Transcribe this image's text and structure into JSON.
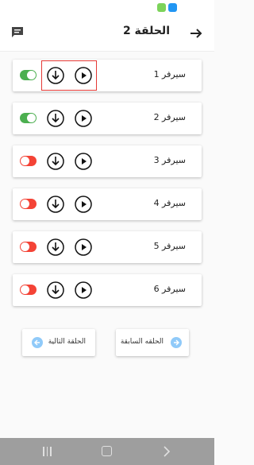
{
  "status_bar": {
    "icons": [
      "android-face-icon",
      "app-badge-icon"
    ]
  },
  "header": {
    "title": "الحلقة 2",
    "back_icon": "arrow-right-icon",
    "chat_icon": "message-icon"
  },
  "servers": [
    {
      "label": "سيرفر 1",
      "enabled": true
    },
    {
      "label": "سيرفر 2",
      "enabled": true
    },
    {
      "label": "سيرفر 3",
      "enabled": false
    },
    {
      "label": "سيرفر 4",
      "enabled": false
    },
    {
      "label": "سيرفر 5",
      "enabled": false
    },
    {
      "label": "سيرفر 6",
      "enabled": false
    }
  ],
  "nav": {
    "previous_label": "الحلقه السابقة",
    "next_label": "الحلقة التالية"
  },
  "colors": {
    "accent_blue": "#90caf9",
    "toggle_on": "#4caf50",
    "toggle_off": "#f44336",
    "highlight": "#e53935"
  }
}
